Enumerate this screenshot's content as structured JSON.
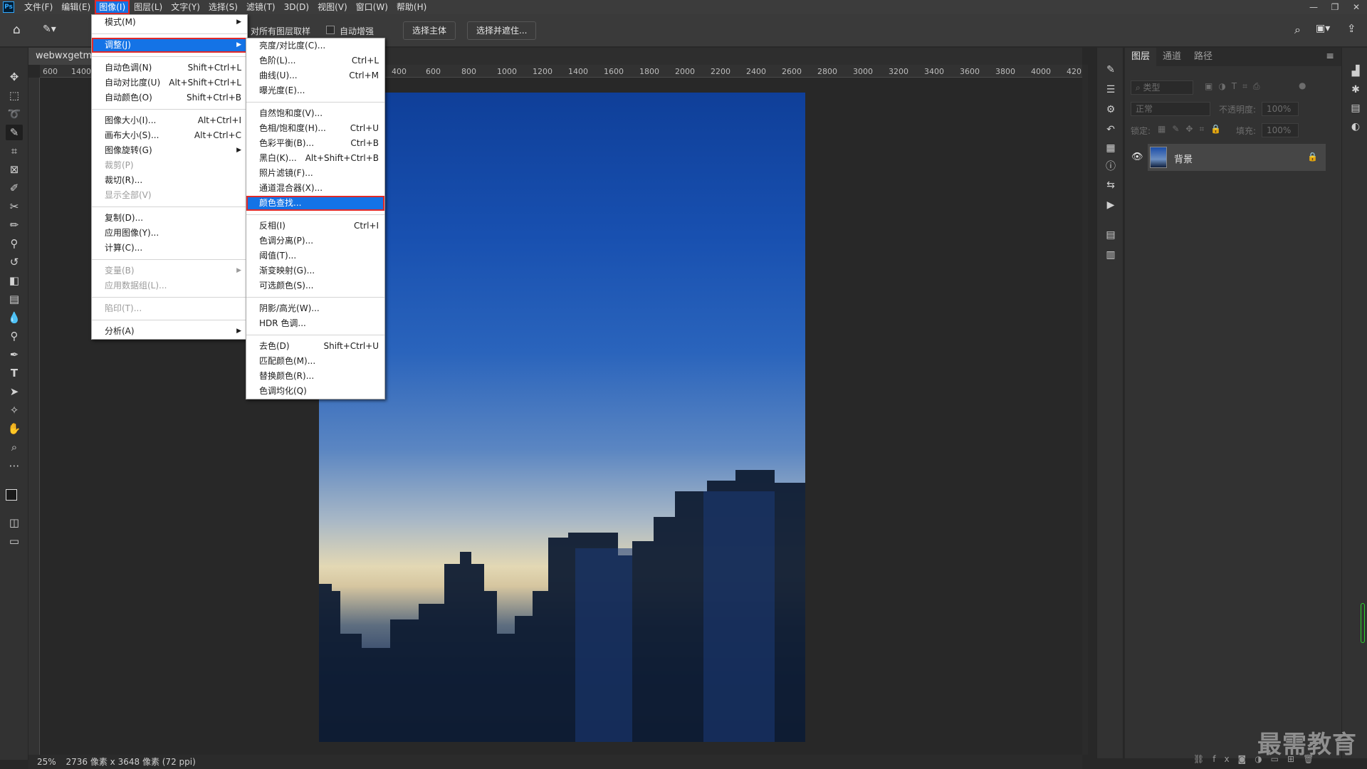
{
  "menubar": {
    "logo": "Ps",
    "items": [
      "文件(F)",
      "编辑(E)",
      "图像(I)",
      "图层(L)",
      "文字(Y)",
      "选择(S)",
      "滤镜(T)",
      "3D(D)",
      "视图(V)",
      "窗口(W)",
      "帮助(H)"
    ],
    "active_index": 2
  },
  "options": {
    "sample_all_layers": "对所有图层取样",
    "auto_enhance": "自动增强",
    "select_subject": "选择主体",
    "select_and_mask": "选择并遮住..."
  },
  "document": {
    "tab_title": "webwxgetmsg",
    "ruler_labels": [
      "600",
      "1400",
      "400",
      "600",
      "800",
      "1000",
      "1200",
      "1400",
      "1600",
      "1800",
      "2000",
      "2200",
      "2400",
      "2600",
      "2800",
      "3000",
      "3200",
      "3400",
      "3600",
      "3800",
      "4000",
      "420"
    ],
    "zoom": "25%",
    "doc_info": "2736 像素 x 3648 像素 (72 ppi)"
  },
  "image_menu": {
    "items": [
      {
        "label": "模式(M)",
        "shortcut": "",
        "submenu": true
      },
      {
        "sep": true
      },
      {
        "label": "调整(J)",
        "shortcut": "",
        "submenu": true,
        "highlight": true
      },
      {
        "sep": true
      },
      {
        "label": "自动色调(N)",
        "shortcut": "Shift+Ctrl+L"
      },
      {
        "label": "自动对比度(U)",
        "shortcut": "Alt+Shift+Ctrl+L"
      },
      {
        "label": "自动颜色(O)",
        "shortcut": "Shift+Ctrl+B"
      },
      {
        "sep": true
      },
      {
        "label": "图像大小(I)...",
        "shortcut": "Alt+Ctrl+I"
      },
      {
        "label": "画布大小(S)...",
        "shortcut": "Alt+Ctrl+C"
      },
      {
        "label": "图像旋转(G)",
        "shortcut": "",
        "submenu": true
      },
      {
        "label": "裁剪(P)",
        "shortcut": "",
        "disabled": true
      },
      {
        "label": "裁切(R)...",
        "shortcut": ""
      },
      {
        "label": "显示全部(V)",
        "shortcut": "",
        "disabled": true
      },
      {
        "sep": true
      },
      {
        "label": "复制(D)...",
        "shortcut": ""
      },
      {
        "label": "应用图像(Y)...",
        "shortcut": ""
      },
      {
        "label": "计算(C)...",
        "shortcut": ""
      },
      {
        "sep": true
      },
      {
        "label": "变量(B)",
        "shortcut": "",
        "submenu": true,
        "disabled": true
      },
      {
        "label": "应用数据组(L)...",
        "shortcut": "",
        "disabled": true
      },
      {
        "sep": true
      },
      {
        "label": "陷印(T)...",
        "shortcut": "",
        "disabled": true
      },
      {
        "sep": true
      },
      {
        "label": "分析(A)",
        "shortcut": "",
        "submenu": true
      }
    ]
  },
  "adjust_menu": {
    "items": [
      {
        "label": "亮度/对比度(C)...",
        "shortcut": ""
      },
      {
        "label": "色阶(L)...",
        "shortcut": "Ctrl+L"
      },
      {
        "label": "曲线(U)...",
        "shortcut": "Ctrl+M"
      },
      {
        "label": "曝光度(E)...",
        "shortcut": ""
      },
      {
        "sep": true
      },
      {
        "label": "自然饱和度(V)...",
        "shortcut": ""
      },
      {
        "label": "色相/饱和度(H)...",
        "shortcut": "Ctrl+U"
      },
      {
        "label": "色彩平衡(B)...",
        "shortcut": "Ctrl+B"
      },
      {
        "label": "黑白(K)...",
        "shortcut": "Alt+Shift+Ctrl+B"
      },
      {
        "label": "照片滤镜(F)...",
        "shortcut": ""
      },
      {
        "label": "通道混合器(X)...",
        "shortcut": ""
      },
      {
        "label": "颜色查找...",
        "shortcut": "",
        "highlight": true
      },
      {
        "sep": true
      },
      {
        "label": "反相(I)",
        "shortcut": "Ctrl+I"
      },
      {
        "label": "色调分离(P)...",
        "shortcut": ""
      },
      {
        "label": "阈值(T)...",
        "shortcut": ""
      },
      {
        "label": "渐变映射(G)...",
        "shortcut": ""
      },
      {
        "label": "可选颜色(S)...",
        "shortcut": ""
      },
      {
        "sep": true
      },
      {
        "label": "阴影/高光(W)...",
        "shortcut": ""
      },
      {
        "label": "HDR 色调...",
        "shortcut": ""
      },
      {
        "sep": true
      },
      {
        "label": "去色(D)",
        "shortcut": "Shift+Ctrl+U"
      },
      {
        "label": "匹配颜色(M)...",
        "shortcut": ""
      },
      {
        "label": "替换颜色(R)...",
        "shortcut": ""
      },
      {
        "label": "色调均化(Q)",
        "shortcut": ""
      }
    ]
  },
  "layers_panel": {
    "tabs": [
      "图层",
      "通道",
      "路径"
    ],
    "filter_label": "类型",
    "blend_mode": "正常",
    "opacity_label": "不透明度:",
    "opacity_value": "100%",
    "lock_label": "锁定:",
    "fill_label": "填充:",
    "fill_value": "100%",
    "layer_name": "背景"
  },
  "watermark": "最需教育",
  "colors": {
    "accent": "#1473e6",
    "highlight_box": "#e02a2a"
  }
}
